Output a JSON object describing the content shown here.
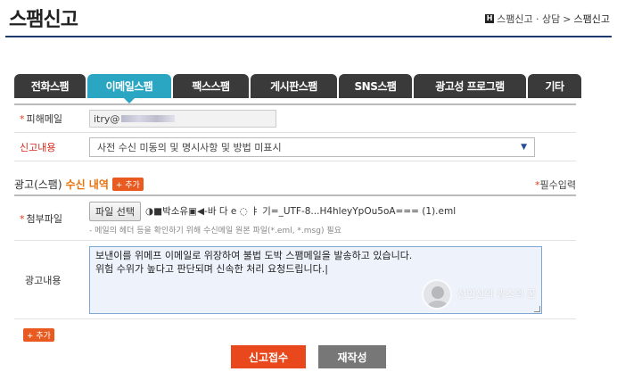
{
  "page": {
    "title": "스팸신고"
  },
  "breadcrumb": {
    "home_glyph": "H",
    "path": "스팸신고 · 상담",
    "separator": ">",
    "current": "스팸신고"
  },
  "tabs": [
    {
      "label": "전화스팸",
      "active": false
    },
    {
      "label": "이메일스팸",
      "active": true
    },
    {
      "label": "팩스스팸",
      "active": false
    },
    {
      "label": "게시판스팸",
      "active": false
    },
    {
      "label": "SNS스팸",
      "active": false
    },
    {
      "label": "광고성 프로그램",
      "active": false
    },
    {
      "label": "기타",
      "active": false
    }
  ],
  "form": {
    "victim_email": {
      "label": "피해메일",
      "required_mark": "*",
      "value": "itry@"
    },
    "report_type": {
      "label": "신고내용",
      "selected": "사전 수신 미동의 및 명시사항 및 방법 미표시"
    }
  },
  "section": {
    "title_prefix": "광고(스팸)",
    "title_accent": "수신 내역",
    "add_label": "+ 추가",
    "required_note_mark": "*",
    "required_note": "필수입력"
  },
  "attachment": {
    "label": "첨부파일",
    "required_mark": "*",
    "button": "파일 선택",
    "file_name": "◑■박소유▣◀-바 다 e ◌ ㅑ 기=_UTF-8...H4hleyYpOu5oA=== (1).eml",
    "help": "- 메일의 헤더 등을 확인하기 위해 수신메일 원본 파일(*.eml, *.msg) 필요"
  },
  "ad_content": {
    "label": "광고내용",
    "text_line1": "보낸이를 위메프 이메일로 위장하여 불법 도박 스팸메일을 발송하고 있습니다.",
    "text_line2": "위험 수위가 높다고 판단되며 신속한 처리 요청드립니다.|",
    "watermark": "선연신의 광초의 꿈"
  },
  "add_more": {
    "label": "+ 추가"
  },
  "actions": {
    "submit": "신고접수",
    "reset": "재작성"
  },
  "colors": {
    "tab_active": "#2aa6c2",
    "tab_inactive": "#3a3a3a",
    "submit": "#e8481c",
    "accent": "#e8710c",
    "rule": "#1e3a6e"
  }
}
